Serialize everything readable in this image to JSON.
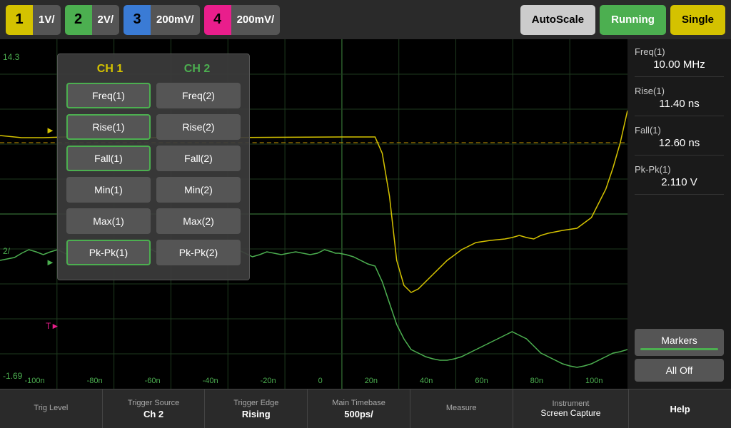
{
  "topbar": {
    "ch1": {
      "num": "1",
      "scale": "1V/"
    },
    "ch2": {
      "num": "2",
      "scale": "2V/"
    },
    "ch3": {
      "num": "3",
      "scale": "200mV/"
    },
    "ch4": {
      "num": "4",
      "scale": "200mV/"
    },
    "autoscale": "AutoScale",
    "running": "Running",
    "single": "Single"
  },
  "scope": {
    "y_labels": [
      "14.3",
      "2/",
      "-1.69"
    ],
    "x_labels": [
      "-100n",
      "-80n",
      "-60n",
      "-40n",
      "-20n",
      "0",
      "20n",
      "40n",
      "60n",
      "80n",
      "100n"
    ],
    "ch2_label": "2/",
    "trigger_label": "T"
  },
  "measure_panel": {
    "ch1_label": "CH 1",
    "ch2_label": "CH 2",
    "buttons": [
      [
        "Freq(1)",
        "Freq(2)"
      ],
      [
        "Rise(1)",
        "Rise(2)"
      ],
      [
        "Fall(1)",
        "Fall(2)"
      ],
      [
        "Min(1)",
        "Min(2)"
      ],
      [
        "Max(1)",
        "Max(2)"
      ],
      [
        "Pk-Pk(1)",
        "Pk-Pk(2)"
      ]
    ],
    "active_buttons": [
      "Freq(1)",
      "Rise(1)",
      "Fall(1)",
      "Pk-Pk(1)"
    ]
  },
  "measurements": [
    {
      "label": "Freq(1)",
      "value": "10.00 MHz"
    },
    {
      "label": "Rise(1)",
      "value": "11.40 ns"
    },
    {
      "label": "Fall(1)",
      "value": "12.60 ns"
    },
    {
      "label": "Pk-Pk(1)",
      "value": "2.110 V"
    }
  ],
  "right_panel": {
    "markers_label": "Markers",
    "alloff_label": "All Off"
  },
  "bottom_bar": [
    {
      "title": "Trig Level",
      "value": ""
    },
    {
      "title": "Trigger Source",
      "value": "Ch 2"
    },
    {
      "title": "Trigger Edge",
      "value": "Rising"
    },
    {
      "title": "Main Timebase",
      "value": "500ps/"
    },
    {
      "title": "Measure",
      "value": ""
    }
  ],
  "instrument": {
    "title": "Instrument",
    "subtitle": "Screen Capture"
  },
  "help": {
    "label": "Help"
  }
}
